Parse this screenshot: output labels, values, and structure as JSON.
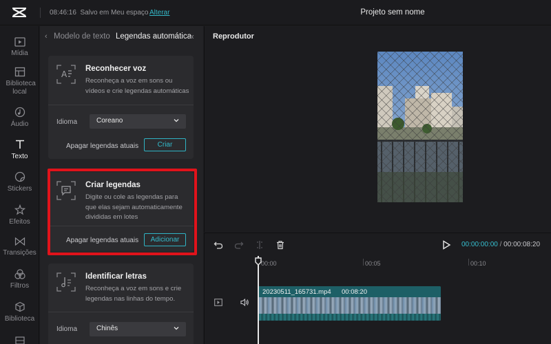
{
  "header": {
    "time": "08:46:16",
    "save_status": "Salvo em Meu espaço",
    "change_link": "Alterar",
    "project_title": "Projeto sem nome"
  },
  "rail": {
    "items": [
      {
        "label": "Mídia",
        "icon": "media-icon"
      },
      {
        "label": "Biblioteca local",
        "icon": "library-local-icon"
      },
      {
        "label": "Áudio",
        "icon": "audio-icon"
      },
      {
        "label": "Texto",
        "icon": "text-icon",
        "active": true
      },
      {
        "label": "Stickers",
        "icon": "stickers-icon"
      },
      {
        "label": "Efeitos",
        "icon": "effects-icon"
      },
      {
        "label": "Transições",
        "icon": "transitions-icon"
      },
      {
        "label": "Filtros",
        "icon": "filters-icon"
      },
      {
        "label": "Biblioteca",
        "icon": "library-icon"
      }
    ]
  },
  "panel": {
    "tab_model": "Modelo de texto",
    "tab_auto": "Legendas automática",
    "cards": {
      "recognize": {
        "title": "Reconhecer voz",
        "desc": "Reconheça a voz em sons ou vídeos e crie legendas automáticas",
        "language_label": "Idioma",
        "language_value": "Coreano",
        "clear_label": "Apagar legendas atuais",
        "button": "Criar"
      },
      "create": {
        "title": "Criar legendas",
        "desc": "Digite ou cole as legendas para que elas sejam automaticamente divididas em lotes",
        "clear_label": "Apagar legendas atuais",
        "button": "Adicionar"
      },
      "lyrics": {
        "title": "Identificar letras",
        "desc": "Reconheça a voz em sons e crie legendas nas linhas do tempo.",
        "language_label": "Idioma",
        "language_value": "Chinês"
      }
    }
  },
  "player": {
    "title": "Reprodutor"
  },
  "timeline": {
    "current_time": "00:00:00:00",
    "separator": "/",
    "total_time": "00:00:08:20",
    "ticks": [
      "00:00",
      "00:05",
      "00:10"
    ],
    "clip": {
      "filename": "20230511_165731.mp4",
      "duration": "00:08:20"
    }
  },
  "colors": {
    "accent": "#34b9c9",
    "highlight": "#e0131b",
    "clip": "#1d6e74"
  }
}
